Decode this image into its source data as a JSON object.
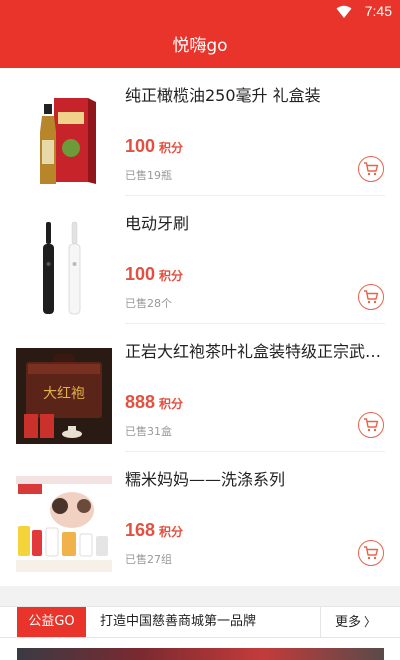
{
  "status_bar": {
    "time": "7:45"
  },
  "app_bar": {
    "title": "悦嗨go"
  },
  "products": [
    {
      "name": "纯正橄榄油250毫升 礼盒装",
      "price": "100",
      "unit": "积分",
      "sold": "已售19瓶",
      "image_icon": "olive-oil-gift-box"
    },
    {
      "name": "电动牙刷",
      "price": "100",
      "unit": "积分",
      "sold": "已售28个",
      "image_icon": "electric-toothbrush"
    },
    {
      "name": "正岩大红袍茶叶礼盒装特级正宗武夷山岩茶",
      "price": "888",
      "unit": "积分",
      "sold": "已售31盒",
      "image_icon": "tea-gift-box"
    },
    {
      "name": "糯米妈妈——洗涤系列",
      "price": "168",
      "unit": "积分",
      "sold": "已售27组",
      "image_icon": "detergent-series"
    }
  ],
  "notice": {
    "tag": "公益GO",
    "text": "打造中国慈善商城第一品牌",
    "more": "更多"
  },
  "colors": {
    "brand": "#e8342a",
    "price": "#e35040",
    "muted": "#999999"
  }
}
